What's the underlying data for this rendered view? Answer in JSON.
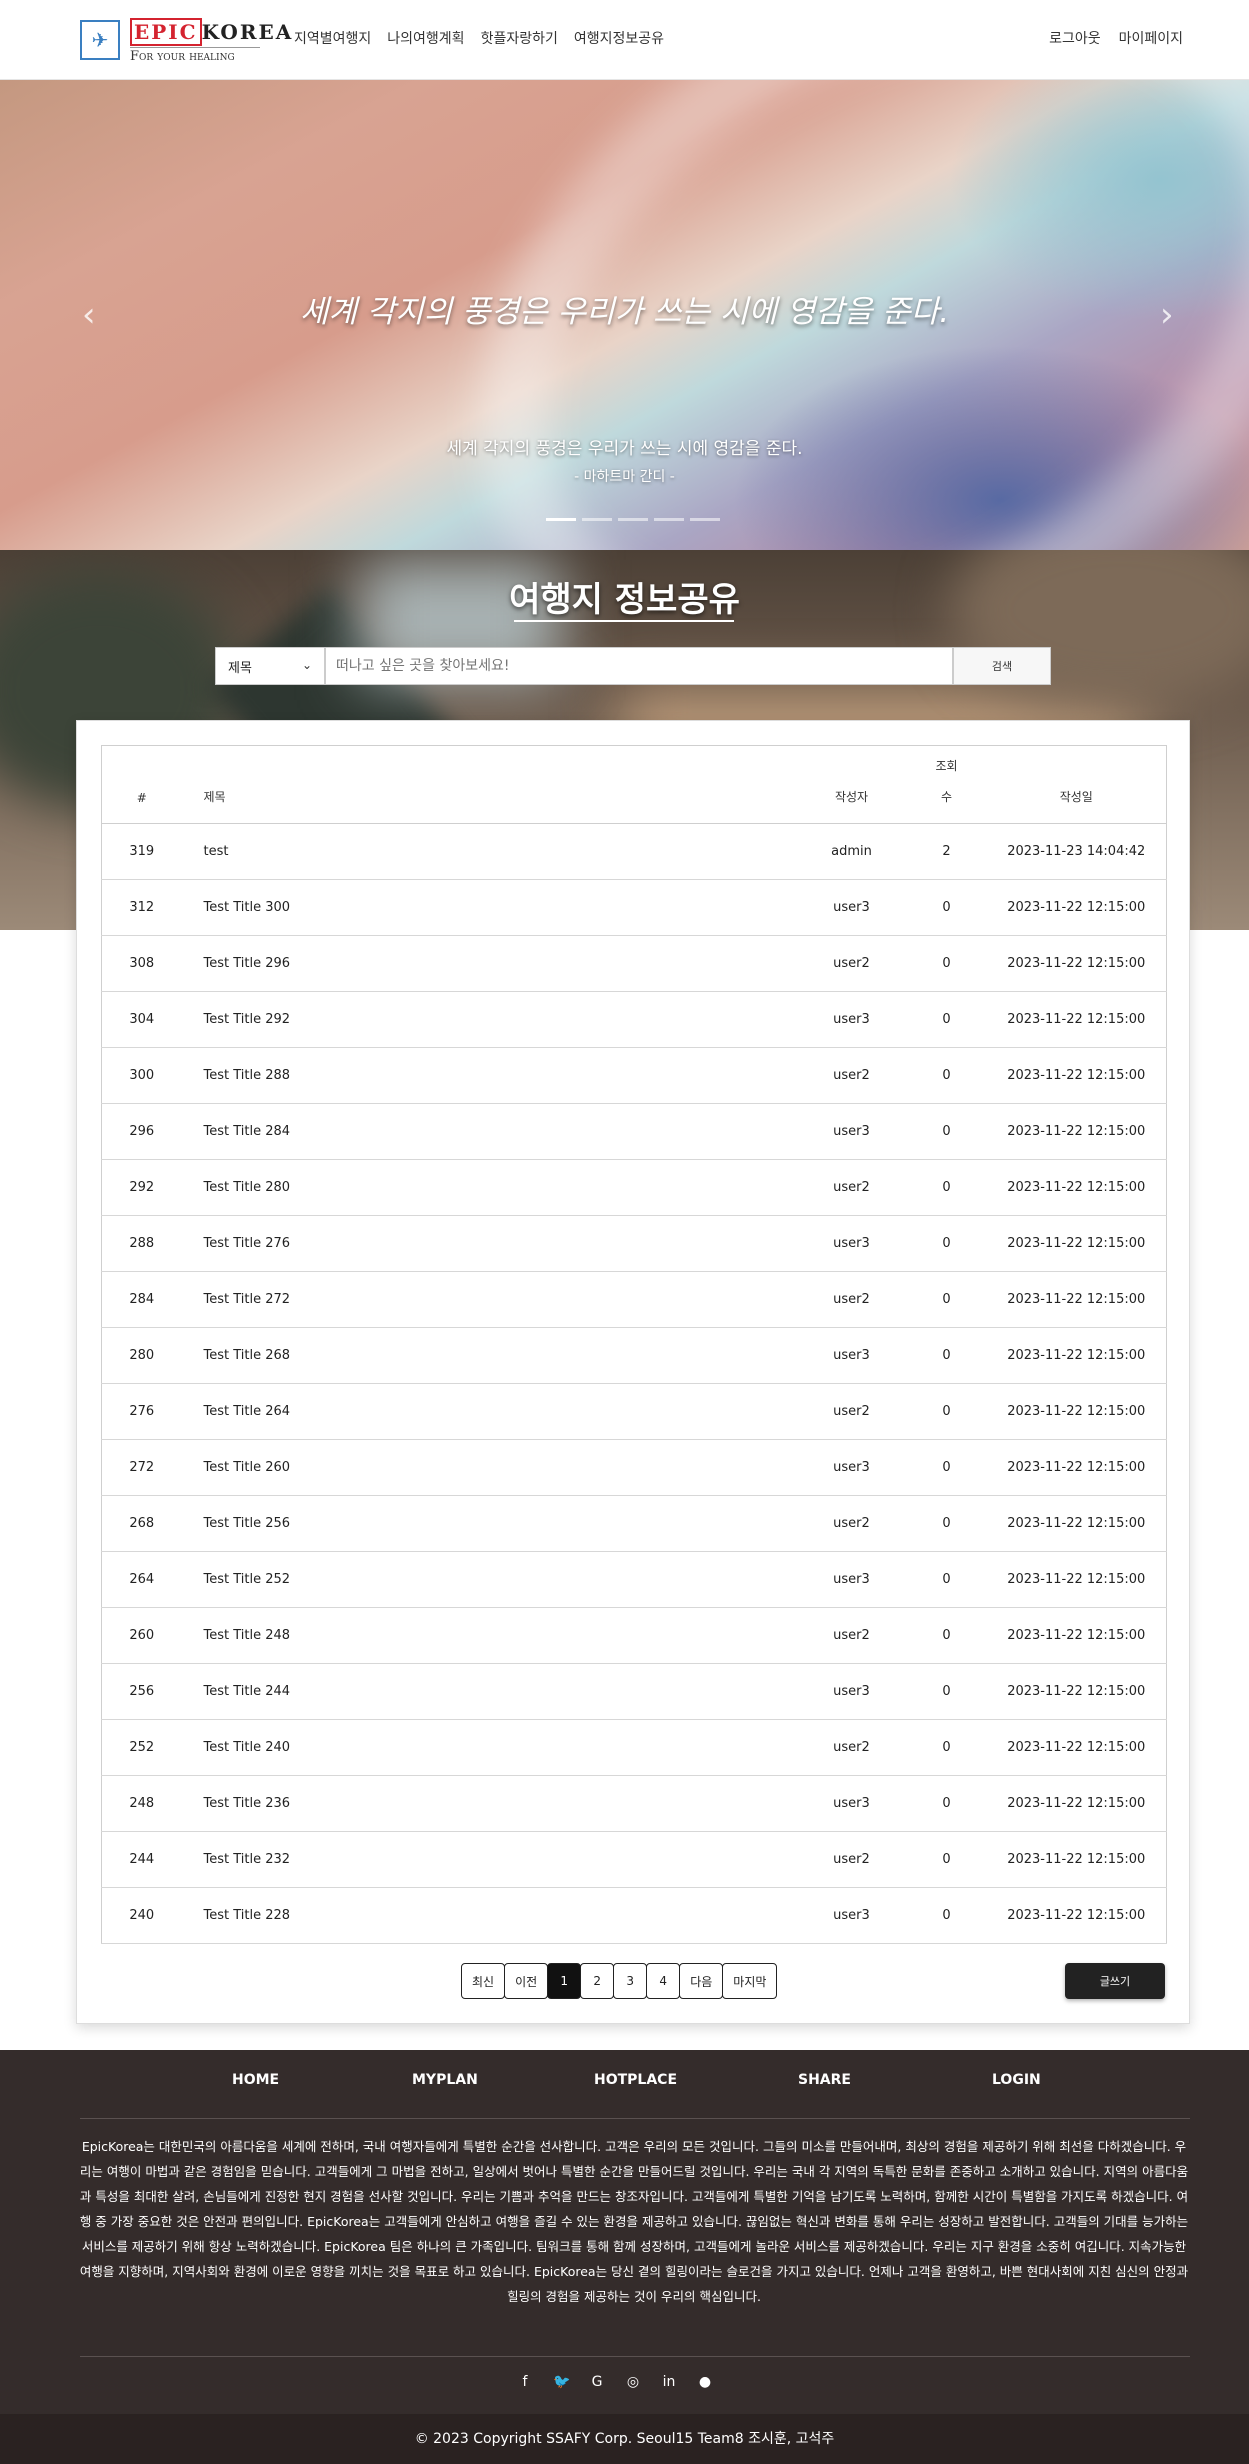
{
  "nav": {
    "logo_epic": "EPIC",
    "logo_korea": "KOREA",
    "logo_tagline": "For your healing",
    "menu": [
      "지역별여행지",
      "나의여행계획",
      "핫플자랑하기",
      "여행지정보공유"
    ],
    "right": [
      "로그아웃",
      "마이페이지"
    ]
  },
  "hero": {
    "title": "세계 각지의 풍경은 우리가 쓰는 시에 영감을 준다.",
    "subtitle": "세계 각지의 풍경은 우리가 쓰는 시에 영감을 준다.",
    "author": "- 마하트마 간디 -",
    "prev_icon": "chevron-left",
    "next_icon": "chevron-right",
    "slide_count": 5,
    "active_slide": 1
  },
  "section": {
    "title": "여행지 정보공유"
  },
  "search": {
    "select_value": "제목",
    "placeholder": "떠나고 싶은 곳을 찾아보세요!",
    "button": "검색"
  },
  "table": {
    "headers": {
      "num": "#",
      "title": "제목",
      "author": "작성자",
      "views_1": "조회",
      "views_2": "수",
      "date": "작성일"
    },
    "rows": [
      {
        "num": "319",
        "title": "test",
        "author": "admin",
        "views": "2",
        "date": "2023-11-23 14:04:42"
      },
      {
        "num": "312",
        "title": "Test Title 300",
        "author": "user3",
        "views": "0",
        "date": "2023-11-22 12:15:00"
      },
      {
        "num": "308",
        "title": "Test Title 296",
        "author": "user2",
        "views": "0",
        "date": "2023-11-22 12:15:00"
      },
      {
        "num": "304",
        "title": "Test Title 292",
        "author": "user3",
        "views": "0",
        "date": "2023-11-22 12:15:00"
      },
      {
        "num": "300",
        "title": "Test Title 288",
        "author": "user2",
        "views": "0",
        "date": "2023-11-22 12:15:00"
      },
      {
        "num": "296",
        "title": "Test Title 284",
        "author": "user3",
        "views": "0",
        "date": "2023-11-22 12:15:00"
      },
      {
        "num": "292",
        "title": "Test Title 280",
        "author": "user2",
        "views": "0",
        "date": "2023-11-22 12:15:00"
      },
      {
        "num": "288",
        "title": "Test Title 276",
        "author": "user3",
        "views": "0",
        "date": "2023-11-22 12:15:00"
      },
      {
        "num": "284",
        "title": "Test Title 272",
        "author": "user2",
        "views": "0",
        "date": "2023-11-22 12:15:00"
      },
      {
        "num": "280",
        "title": "Test Title 268",
        "author": "user3",
        "views": "0",
        "date": "2023-11-22 12:15:00"
      },
      {
        "num": "276",
        "title": "Test Title 264",
        "author": "user2",
        "views": "0",
        "date": "2023-11-22 12:15:00"
      },
      {
        "num": "272",
        "title": "Test Title 260",
        "author": "user3",
        "views": "0",
        "date": "2023-11-22 12:15:00"
      },
      {
        "num": "268",
        "title": "Test Title 256",
        "author": "user2",
        "views": "0",
        "date": "2023-11-22 12:15:00"
      },
      {
        "num": "264",
        "title": "Test Title 252",
        "author": "user3",
        "views": "0",
        "date": "2023-11-22 12:15:00"
      },
      {
        "num": "260",
        "title": "Test Title 248",
        "author": "user2",
        "views": "0",
        "date": "2023-11-22 12:15:00"
      },
      {
        "num": "256",
        "title": "Test Title 244",
        "author": "user3",
        "views": "0",
        "date": "2023-11-22 12:15:00"
      },
      {
        "num": "252",
        "title": "Test Title 240",
        "author": "user2",
        "views": "0",
        "date": "2023-11-22 12:15:00"
      },
      {
        "num": "248",
        "title": "Test Title 236",
        "author": "user3",
        "views": "0",
        "date": "2023-11-22 12:15:00"
      },
      {
        "num": "244",
        "title": "Test Title 232",
        "author": "user2",
        "views": "0",
        "date": "2023-11-22 12:15:00"
      },
      {
        "num": "240",
        "title": "Test Title 228",
        "author": "user3",
        "views": "0",
        "date": "2023-11-22 12:15:00"
      }
    ]
  },
  "pagination": {
    "first": "최신",
    "prev": "이전",
    "pages": [
      "1",
      "2",
      "3",
      "4"
    ],
    "active": "1",
    "next": "다음",
    "last": "마지막"
  },
  "write_button": "글쓰기",
  "footer": {
    "links": [
      "HOME",
      "MYPLAN",
      "HOTPLACE",
      "SHARE",
      "LOGIN"
    ],
    "text": "EpicKorea는 대한민국의 아름다움을 세계에 전하며, 국내 여행자들에게 특별한 순간을 선사합니다. 고객은 우리의 모든 것입니다. 그들의 미소를 만들어내며, 최상의 경험을 제공하기 위해 최선을 다하겠습니다. 우리는 여행이 마법과 같은 경험임을 믿습니다. 고객들에게 그 마법을 전하고, 일상에서 벗어나 특별한 순간을 만들어드릴 것입니다. 우리는 국내 각 지역의 독특한 문화를 존중하고 소개하고 있습니다. 지역의 아름다움과 특성을 최대한 살려, 손님들에게 진정한 현지 경험을 선사할 것입니다. 우리는 기쁨과 추억을 만드는 창조자입니다. 고객들에게 특별한 기억을 남기도록 노력하며, 함께한 시간이 특별함을 가지도록 하겠습니다. 여행 중 가장 중요한 것은 안전과 편의입니다. EpicKorea는 고객들에게 안심하고 여행을 즐길 수 있는 환경을 제공하고 있습니다. 끊임없는 혁신과 변화를 통해 우리는 성장하고 발전합니다. 고객들의 기대를 능가하는 서비스를 제공하기 위해 항상 노력하겠습니다. EpicKorea 팀은 하나의 큰 가족입니다. 팀워크를 통해 함께 성장하며, 고객들에게 놀라운 서비스를 제공하겠습니다. 우리는 지구 환경을 소중히 여깁니다. 지속가능한 여행을 지향하며, 지역사회와 환경에 이로운 영향을 끼치는 것을 목표로 하고 있습니다. EpicKorea는 당신 곁의 힐링이라는 슬로건을 가지고 있습니다. 언제나 고객을 환영하고, 바쁜 현대사회에 지친 심신의 안정과 힐링의 경험을 제공하는 것이 우리의 핵심입니다.",
    "social_icons": [
      "facebook-icon",
      "twitter-icon",
      "google-icon",
      "instagram-icon",
      "linkedin-icon",
      "github-icon"
    ]
  },
  "copyright": "© 2023 Copyright SSAFY Corp. Seoul15 Team8 조시훈, 고석주",
  "colors": {
    "footer_bg": "#342c2b",
    "copyright_bg": "#2a2221",
    "logo_red": "#d4232f",
    "logo_blue": "#3a7fc1"
  }
}
